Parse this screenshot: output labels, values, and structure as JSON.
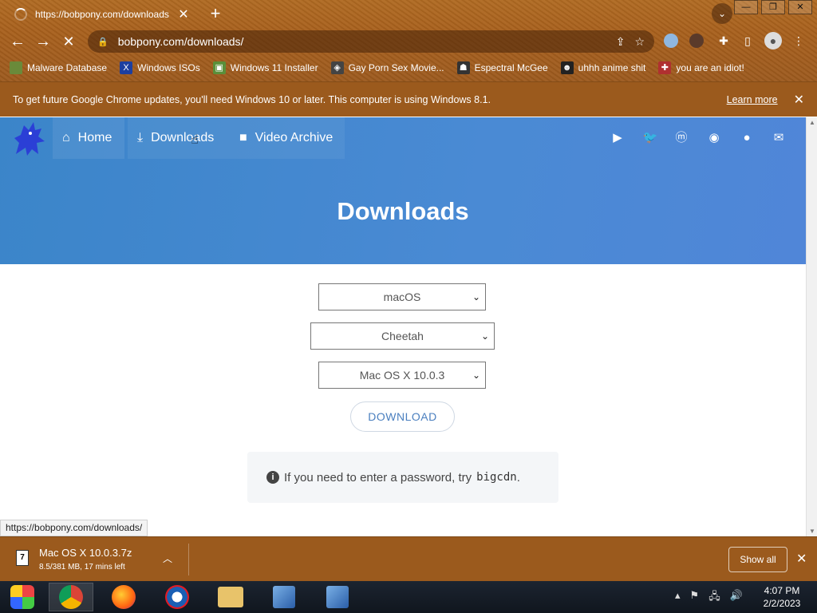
{
  "browser": {
    "tab_title": "https://bobpony.com/downloads/",
    "new_tab_label": "+",
    "url": "bobpony.com/downloads/",
    "bookmarks": [
      {
        "label": "Malware Database",
        "icon": "bug-icon",
        "color": "#6a8a3a"
      },
      {
        "label": "Windows ISOs",
        "icon": "x-icon",
        "color": "#1d3fa0"
      },
      {
        "label": "Windows 11 Installer",
        "icon": "image-icon",
        "color": "#5a8f3a"
      },
      {
        "label": "Gay Porn Sex Movie...",
        "icon": "cube-icon",
        "color": "#444444"
      },
      {
        "label": "Espectral McGee",
        "icon": "ghost-icon",
        "color": "#333333"
      },
      {
        "label": "uhhh anime shit",
        "icon": "anime-icon",
        "color": "#222222"
      },
      {
        "label": "you are an idiot!",
        "icon": "flag-icon",
        "color": "#b03030"
      }
    ],
    "infobar": {
      "message": "To get future Google Chrome updates, you'll need Windows 10 or later. This computer is using Windows 8.1.",
      "link": "Learn more"
    }
  },
  "site": {
    "nav": [
      {
        "label": "Home",
        "icon": "home-icon"
      },
      {
        "label": "Downloads",
        "icon": "download-icon"
      },
      {
        "label": "Video Archive",
        "icon": "video-icon"
      }
    ],
    "social_icons": [
      "youtube-icon",
      "twitter-icon",
      "mastodon-icon",
      "discord-icon",
      "github-icon",
      "mail-icon"
    ],
    "title": "Downloads",
    "selects": {
      "os": "macOS",
      "release": "Cheetah",
      "version": "Mac OS X 10.0.3"
    },
    "download_button": "DOWNLOAD",
    "notice": {
      "text": "If you need to enter a password, try",
      "password": "bigcdn",
      "period": "."
    }
  },
  "status_bar_url": "https://bobpony.com/downloads/",
  "download_shelf": {
    "filename": "Mac OS X 10.0.3.7z",
    "progress": "8.5/381 MB, 17 mins left",
    "show_all": "Show all"
  },
  "taskbar": {
    "apps": [
      "start-icon",
      "chrome-icon",
      "firefox-icon",
      "obama-icon",
      "file-explorer-icon",
      "installer-icon",
      "installer-icon-2"
    ],
    "time": "4:07 PM",
    "date": "2/2/2023"
  }
}
